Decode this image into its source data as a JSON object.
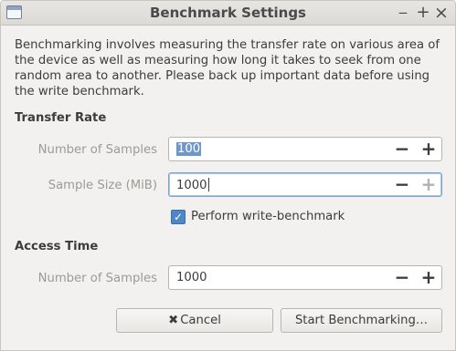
{
  "window": {
    "title": "Benchmark Settings",
    "min_glyph": "‒",
    "max_glyph": "+",
    "close_glyph": "×"
  },
  "description": "Benchmarking involves measuring the transfer rate on various area of the device as well as measuring how long it takes to seek from one random area to another. Please back up important data before using the write benchmark.",
  "transfer_rate": {
    "title": "Transfer Rate",
    "samples_label": "Number of Samples",
    "samples_value": "100",
    "size_label": "Sample Size (MiB)",
    "size_value": "1000",
    "write_checkbox_label": "Perform write-benchmark",
    "write_checked": true
  },
  "access_time": {
    "title": "Access Time",
    "samples_label": "Number of Samples",
    "samples_value": "1000"
  },
  "spin": {
    "minus": "−",
    "plus": "+"
  },
  "buttons": {
    "cancel_icon": "✖",
    "cancel": "Cancel",
    "start": "Start Benchmarking…"
  },
  "colors": {
    "accent": "#4f86c6",
    "selection": "#6f98c9",
    "focus_border": "#7ba4d3",
    "dim_label": "#9e9a94"
  }
}
